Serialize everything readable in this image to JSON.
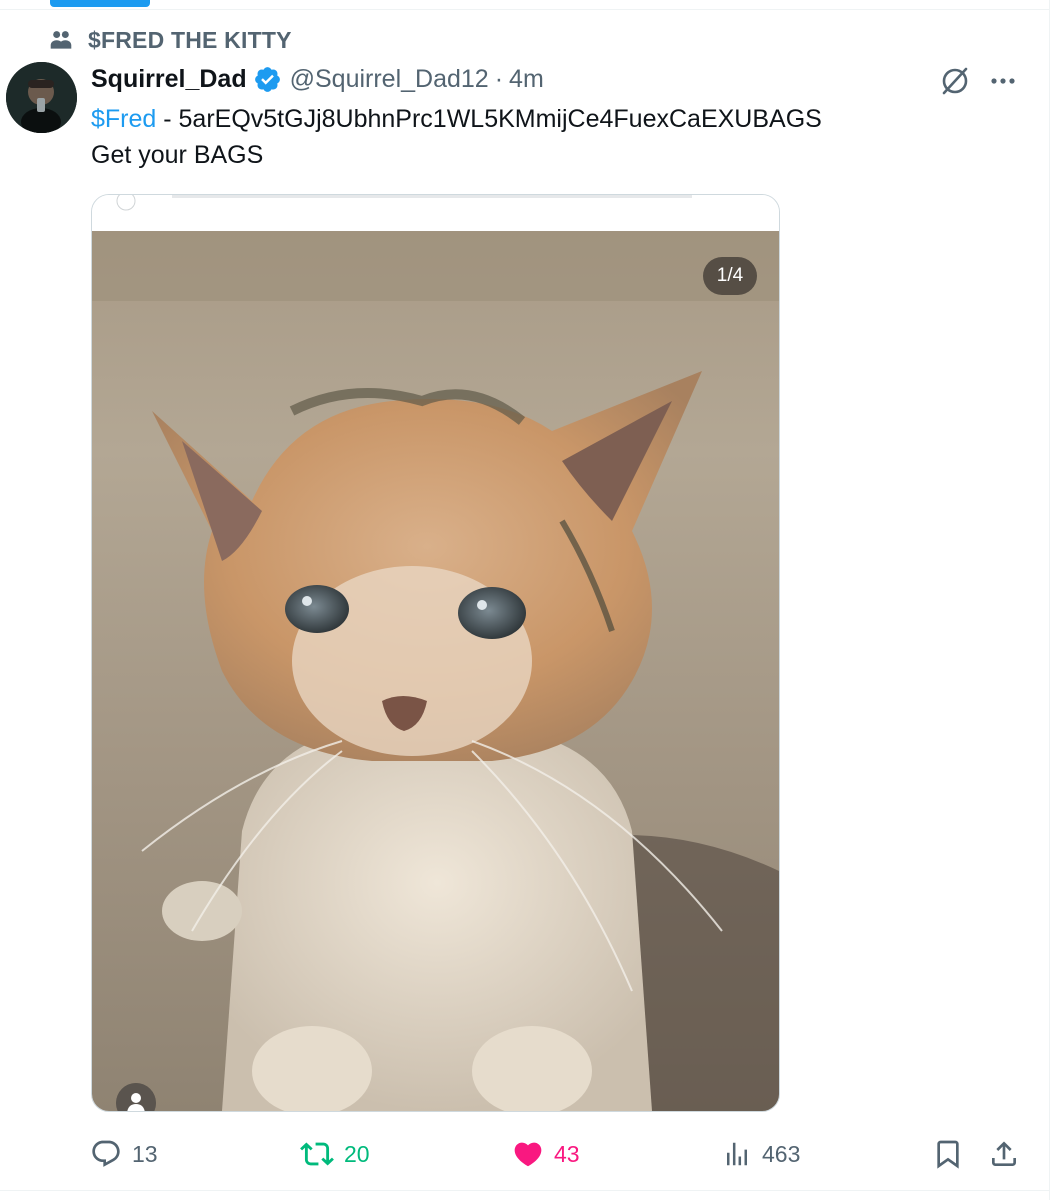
{
  "community": {
    "name": "$FRED THE KITTY",
    "icon": "community-icon"
  },
  "author": {
    "display_name": "Squirrel_Dad",
    "handle": "@Squirrel_Dad12",
    "separator": "·",
    "timestamp": "4m",
    "verified": true
  },
  "tweet": {
    "cashtag": "$Fred",
    "line1_rest": " - 5arEQv5tGJj8UbhnPrc1WL5KMmijCe4FuexCaEXUBAGS",
    "line2": "Get your BAGS"
  },
  "media": {
    "counter": "1/4",
    "description_icon": "person-icon"
  },
  "actions": {
    "replies": "13",
    "reposts": "20",
    "likes": "43",
    "views": "463"
  },
  "colors": {
    "accent": "#1d9bf0",
    "secondary_text": "#536471",
    "repost_active": "#00ba7c",
    "like_active": "#f91880"
  }
}
